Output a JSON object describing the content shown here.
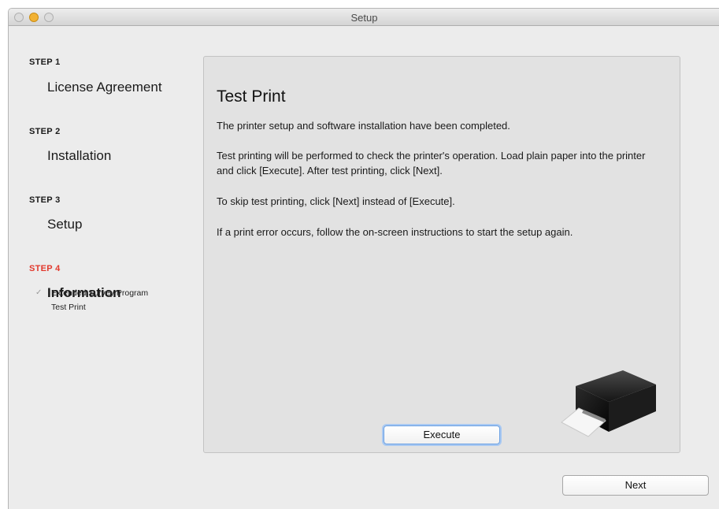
{
  "window": {
    "title": "Setup"
  },
  "steps": [
    {
      "label": "STEP 1",
      "name": "License Agreement",
      "active": false
    },
    {
      "label": "STEP 2",
      "name": "Installation",
      "active": false
    },
    {
      "label": "STEP 3",
      "name": "Setup",
      "active": false
    },
    {
      "label": "STEP 4",
      "name": "Information",
      "active": true
    }
  ],
  "substeps": [
    "Extended Survey Program",
    "Test Print"
  ],
  "panel": {
    "title": "Test Print",
    "paragraphs": [
      "The printer setup and software installation have been completed.",
      "Test printing will be performed to check the printer's operation. Load plain paper into the printer and click [Execute]. After test printing, click [Next].",
      "To skip test printing, click [Next] instead of [Execute].",
      "If a print error occurs, follow the on-screen instructions to start the setup again."
    ],
    "execute_label": "Execute"
  },
  "footer": {
    "next_label": "Next"
  },
  "colors": {
    "active_step": "#e2392d",
    "panel_bg": "#e2e2e2",
    "window_bg": "#ececec"
  },
  "icons": {
    "substep_check": "checkmark-icon",
    "illustration": "printer-icon"
  }
}
